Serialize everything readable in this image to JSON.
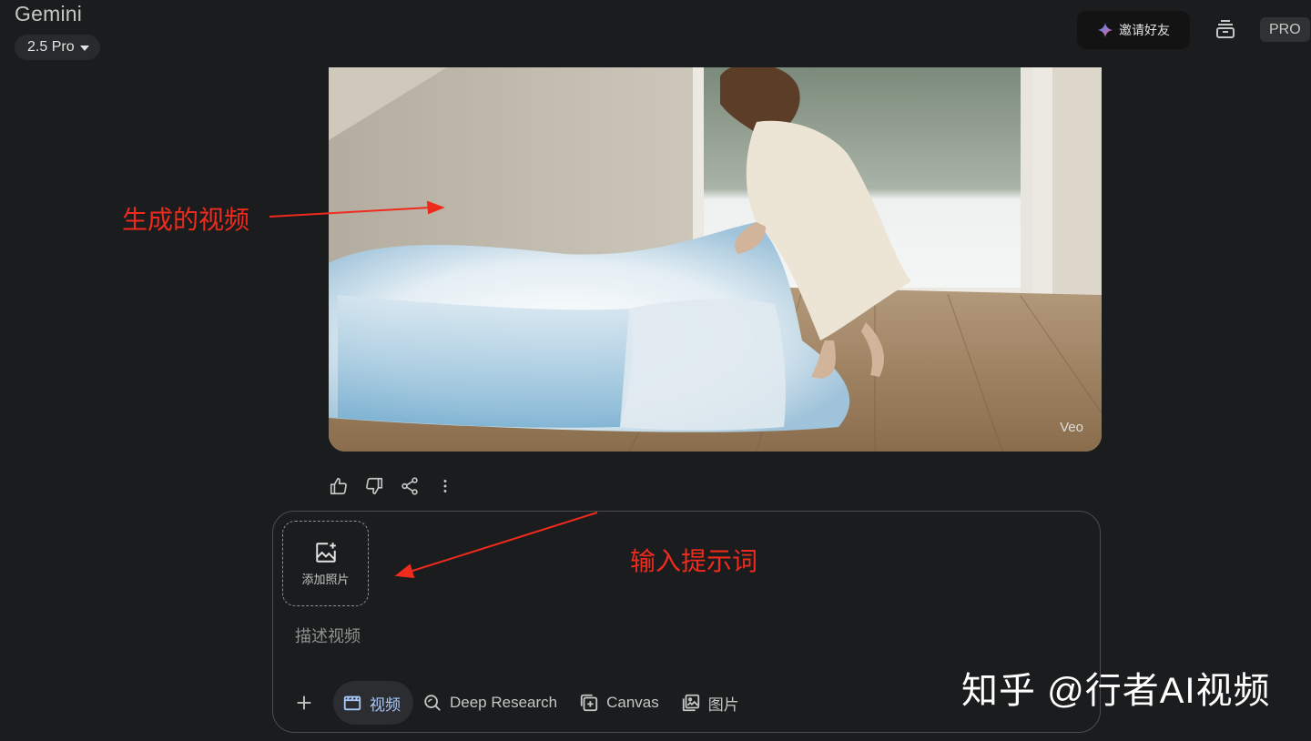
{
  "header": {
    "app_name": "Gemini",
    "model_label": "2.5 Pro",
    "invite_label": "邀请好友",
    "plan_badge": "PRO"
  },
  "video": {
    "watermark": "Veo"
  },
  "response_actions": [
    "thumb-up-icon",
    "thumb-down-icon",
    "share-icon",
    "more-vert-icon"
  ],
  "composer": {
    "add_photo_label": "添加照片",
    "placeholder": "描述视频",
    "tools": [
      {
        "label": "视频",
        "icon": "video-icon",
        "active": true
      },
      {
        "label": "Deep Research",
        "icon": "deep-research-icon",
        "active": false
      },
      {
        "label": "Canvas",
        "icon": "canvas-icon",
        "active": false
      },
      {
        "label": "图片",
        "icon": "image-icon",
        "active": false
      }
    ]
  },
  "annotations": {
    "generated_video": "生成的视频",
    "enter_prompt": "输入提示词"
  },
  "watermark_text": "知乎 @行者AI视频",
  "colors": {
    "background": "#1b1c1d",
    "active_tool": "#a8c7fa",
    "annotation": "#ee2b1d"
  }
}
